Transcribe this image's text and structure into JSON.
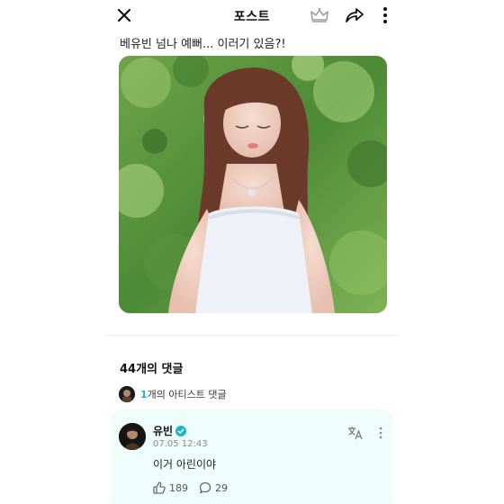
{
  "header": {
    "title": "포스트",
    "close_icon": "close-icon",
    "crown_icon": "crown-icon",
    "share_icon": "share-icon",
    "more_icon": "more-vertical-icon"
  },
  "post": {
    "text": "베유빈 넘나 예뻐... 이러기 있음?!",
    "image": "photo"
  },
  "comments": {
    "count_label": "44개의 댓글",
    "artist_count": "1",
    "artist_label": "개의 아티스트 댓글",
    "items": [
      {
        "author": "유빈",
        "verified": true,
        "time": "07.05 12:43",
        "text": "이거 아린이야",
        "likes": "189",
        "replies": "29"
      }
    ]
  },
  "colors": {
    "accent": "#1ab7c8",
    "comment_bg": "#eefcfa",
    "crown": "#9a9a9a"
  }
}
